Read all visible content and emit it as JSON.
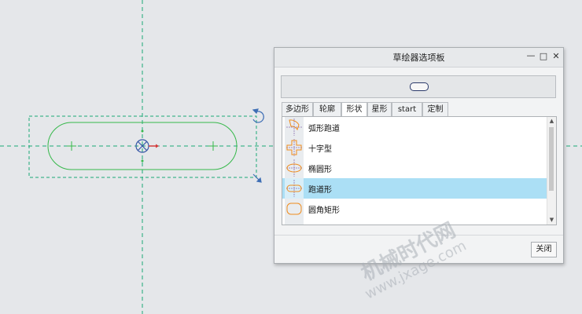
{
  "window": {
    "title": "草绘器选项板",
    "minimize_glyph": "—",
    "maximize_glyph": "□",
    "close_glyph": "✕"
  },
  "tabs": [
    {
      "label": "多边形",
      "active": false
    },
    {
      "label": "轮廓",
      "active": false
    },
    {
      "label": "形状",
      "active": true
    },
    {
      "label": "星形",
      "active": false
    },
    {
      "label": "start",
      "active": false
    },
    {
      "label": "定制",
      "active": false
    }
  ],
  "shapes": [
    {
      "label": "弧形跑道",
      "icon": "arc-racetrack-icon",
      "selected": false
    },
    {
      "label": "十字型",
      "icon": "cross-shape-icon",
      "selected": false
    },
    {
      "label": "椭圆形",
      "icon": "ellipse-icon",
      "selected": false
    },
    {
      "label": "跑道形",
      "icon": "racetrack-icon",
      "selected": true
    },
    {
      "label": "圆角矩形",
      "icon": "rounded-rectangle-icon",
      "selected": false
    }
  ],
  "buttons": {
    "close": "关闭"
  },
  "watermark": {
    "line1": "机械时代网",
    "line2": "www.jxage.com"
  },
  "colors": {
    "canvas_bg": "#e5e7ea",
    "centerline": "#1aa875",
    "sketch": "#35b84a",
    "selection": "#1aa875",
    "selected_item": "#abdff5",
    "icon_orange": "#f08c1c"
  }
}
